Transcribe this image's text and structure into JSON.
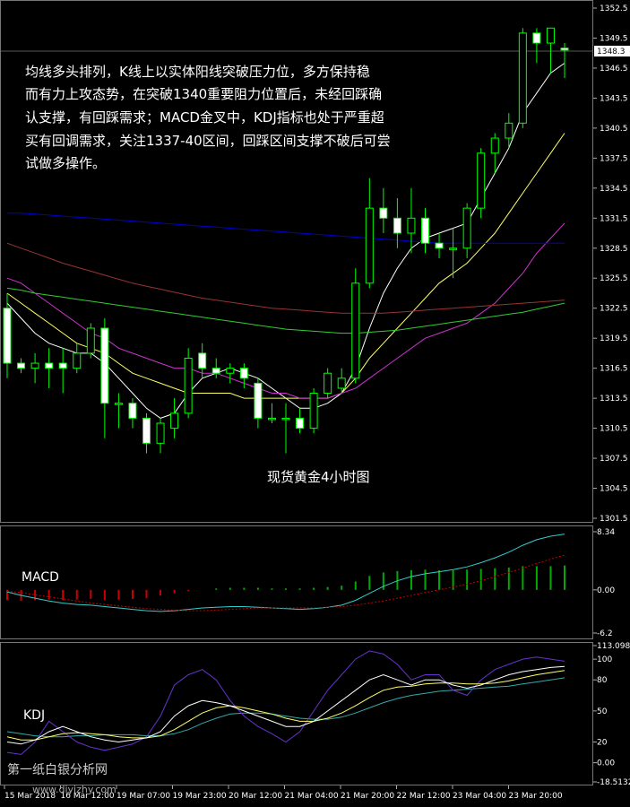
{
  "annotation": {
    "lines": [
      "均线多头排列，K线上以实体阳线突破压力位，多方保持稳",
      "而有力上攻态势，在突破1340重要阻力位置后，未经回踩确",
      "认支撑，有回踩需求；MACD金叉中，KDJ指标也处于严重超",
      "买有回调需求，关注1337-40区间，回踩区间支撑不破后可尝",
      "试做多操作。"
    ]
  },
  "watermark": {
    "text": "第一纸白银分析网",
    "url": "www.diyizhy.com"
  },
  "colors": {
    "background": "#000000",
    "grid": "#1a1a1a",
    "candle": "#00ff00",
    "candle_up_fill": "#000000",
    "candle_down_fill": "#ffffff",
    "ma_white": "#ffffff",
    "ma_yellow": "#ffff66",
    "ma_magenta": "#cc33cc",
    "ma_green": "#33cc33",
    "ma_brown": "#993333",
    "ma_blue": "#0000cc",
    "macd_line": "#33cccc",
    "macd_signal": "#cc0000",
    "macd_hist_pos": "#00aa00",
    "macd_hist_neg": "#cc0000",
    "kdj_k": "#ffffff",
    "kdj_d": "#ffff66",
    "kdj_j": "#6633cc",
    "kdj_extra": "#33aaaa"
  },
  "chart_data": [
    {
      "type": "candlestick",
      "title": "现货黄金4小时图",
      "current_price": "1348.3",
      "ylim": [
        1301.5,
        1352.5
      ],
      "y_ticks": [
        "1352.5",
        "1349.5",
        "1346.5",
        "1343.5",
        "1340.5",
        "1337.5",
        "1334.5",
        "1331.5",
        "1328.5",
        "1325.5",
        "1322.5",
        "1319.5",
        "1316.5",
        "1313.5",
        "1310.5",
        "1307.5",
        "1304.5",
        "1301.5"
      ],
      "x_ticks": [
        "15 Mar 2018",
        "16 Mar 12:00",
        "19 Mar 07:00",
        "19 Mar 23:00",
        "20 Mar 12:00",
        "21 Mar 04:00",
        "21 Mar 20:00",
        "22 Mar 12:00",
        "23 Mar 04:00",
        "23 Mar 20:00"
      ],
      "candles": [
        {
          "o": 1322.5,
          "h": 1324.0,
          "l": 1315.5,
          "c": 1317.0
        },
        {
          "o": 1317.0,
          "h": 1317.5,
          "l": 1316.0,
          "c": 1316.5
        },
        {
          "o": 1316.5,
          "h": 1318.0,
          "l": 1315.0,
          "c": 1317.0
        },
        {
          "o": 1317.0,
          "h": 1318.5,
          "l": 1314.5,
          "c": 1316.5
        },
        {
          "o": 1317.0,
          "h": 1318.5,
          "l": 1314.0,
          "c": 1316.5
        },
        {
          "o": 1316.5,
          "h": 1319.0,
          "l": 1316.0,
          "c": 1318.0
        },
        {
          "o": 1318.0,
          "h": 1321.0,
          "l": 1317.5,
          "c": 1320.5
        },
        {
          "o": 1320.5,
          "h": 1321.5,
          "l": 1309.5,
          "c": 1313.0
        },
        {
          "o": 1313.0,
          "h": 1314.0,
          "l": 1310.5,
          "c": 1313.0
        },
        {
          "o": 1313.0,
          "h": 1313.5,
          "l": 1310.5,
          "c": 1311.5
        },
        {
          "o": 1311.5,
          "h": 1312.0,
          "l": 1308.0,
          "c": 1309.0
        },
        {
          "o": 1309.0,
          "h": 1311.5,
          "l": 1308.0,
          "c": 1311.0
        },
        {
          "o": 1310.5,
          "h": 1313.5,
          "l": 1309.5,
          "c": 1312.0
        },
        {
          "o": 1312.0,
          "h": 1318.5,
          "l": 1311.5,
          "c": 1317.5
        },
        {
          "o": 1318.0,
          "h": 1319.0,
          "l": 1315.5,
          "c": 1316.5
        },
        {
          "o": 1316.5,
          "h": 1317.5,
          "l": 1315.5,
          "c": 1316.0
        },
        {
          "o": 1316.0,
          "h": 1317.0,
          "l": 1315.0,
          "c": 1316.5
        },
        {
          "o": 1316.5,
          "h": 1317.0,
          "l": 1314.5,
          "c": 1315.5
        },
        {
          "o": 1315.0,
          "h": 1315.5,
          "l": 1310.5,
          "c": 1311.5
        },
        {
          "o": 1311.5,
          "h": 1313.0,
          "l": 1311.0,
          "c": 1311.5
        },
        {
          "o": 1311.5,
          "h": 1313.0,
          "l": 1308.0,
          "c": 1311.5
        },
        {
          "o": 1311.5,
          "h": 1312.5,
          "l": 1310.0,
          "c": 1310.5
        },
        {
          "o": 1310.5,
          "h": 1314.5,
          "l": 1310.0,
          "c": 1314.0
        },
        {
          "o": 1314.0,
          "h": 1316.5,
          "l": 1313.5,
          "c": 1316.0
        },
        {
          "o": 1314.5,
          "h": 1316.5,
          "l": 1314.0,
          "c": 1315.5
        },
        {
          "o": 1315.5,
          "h": 1326.5,
          "l": 1315.0,
          "c": 1325.0
        },
        {
          "o": 1325.0,
          "h": 1335.5,
          "l": 1324.5,
          "c": 1332.5
        },
        {
          "o": 1332.5,
          "h": 1334.5,
          "l": 1330.0,
          "c": 1331.5
        },
        {
          "o": 1331.5,
          "h": 1333.5,
          "l": 1328.5,
          "c": 1330.0
        },
        {
          "o": 1330.0,
          "h": 1334.5,
          "l": 1328.0,
          "c": 1331.5
        },
        {
          "o": 1331.5,
          "h": 1332.5,
          "l": 1328.0,
          "c": 1329.0
        },
        {
          "o": 1329.0,
          "h": 1330.0,
          "l": 1327.5,
          "c": 1328.5
        },
        {
          "o": 1328.5,
          "h": 1330.5,
          "l": 1325.5,
          "c": 1328.5
        },
        {
          "o": 1328.5,
          "h": 1333.0,
          "l": 1327.5,
          "c": 1332.5
        },
        {
          "o": 1332.5,
          "h": 1338.5,
          "l": 1331.5,
          "c": 1338.0
        },
        {
          "o": 1338.0,
          "h": 1340.0,
          "l": 1336.0,
          "c": 1339.5
        },
        {
          "o": 1339.5,
          "h": 1342.0,
          "l": 1338.5,
          "c": 1341.0
        },
        {
          "o": 1341.0,
          "h": 1350.5,
          "l": 1340.5,
          "c": 1350.0
        },
        {
          "o": 1350.0,
          "h": 1350.5,
          "l": 1347.0,
          "c": 1349.0
        },
        {
          "o": 1349.0,
          "h": 1350.5,
          "l": 1346.0,
          "c": 1350.5
        },
        {
          "o": 1348.5,
          "h": 1349.0,
          "l": 1345.5,
          "c": 1348.3
        }
      ],
      "moving_averages": [
        {
          "color_key": "ma_white",
          "values": [
            1323.0,
            1321.5,
            1320.0,
            1319.0,
            1318.5,
            1318.0,
            1318.0,
            1317.0,
            1315.5,
            1314.0,
            1312.5,
            1311.5,
            1312.0,
            1314.0,
            1315.5,
            1316.0,
            1316.5,
            1316.0,
            1315.5,
            1314.5,
            1313.5,
            1312.5,
            1312.5,
            1313.0,
            1314.0,
            1316.5,
            1320.5,
            1324.0,
            1326.5,
            1328.5,
            1329.5,
            1330.0,
            1330.5,
            1331.0,
            1333.5,
            1336.0,
            1338.5,
            1342.0,
            1344.0,
            1346.0,
            1347.0
          ]
        },
        {
          "color_key": "ma_yellow",
          "values": [
            1324.0,
            1323.0,
            1322.0,
            1321.0,
            1320.0,
            1319.0,
            1318.5,
            1318.0,
            1317.0,
            1316.0,
            1315.5,
            1315.0,
            1314.5,
            1314.0,
            1314.0,
            1314.0,
            1314.0,
            1313.5,
            1313.5,
            1313.5,
            1313.5,
            1313.5,
            1313.5,
            1313.5,
            1314.0,
            1315.5,
            1317.5,
            1319.0,
            1320.5,
            1322.0,
            1323.5,
            1325.0,
            1326.0,
            1327.0,
            1328.5,
            1330.0,
            1332.0,
            1334.0,
            1336.0,
            1338.0,
            1340.0
          ]
        },
        {
          "color_key": "ma_magenta",
          "values": [
            1325.5,
            1325.0,
            1324.0,
            1323.0,
            1322.0,
            1321.0,
            1320.0,
            1319.5,
            1318.5,
            1318.0,
            1317.5,
            1317.0,
            1316.5,
            1316.5,
            1316.0,
            1316.0,
            1315.5,
            1315.0,
            1314.5,
            1314.0,
            1314.0,
            1313.5,
            1313.5,
            1313.5,
            1314.0,
            1314.5,
            1315.5,
            1316.5,
            1317.5,
            1318.5,
            1319.5,
            1320.0,
            1320.5,
            1321.0,
            1322.0,
            1323.0,
            1324.5,
            1326.0,
            1328.0,
            1329.5,
            1331.0
          ]
        },
        {
          "color_key": "ma_green",
          "values": [
            1324.5,
            1324.3,
            1324.0,
            1323.8,
            1323.6,
            1323.4,
            1323.2,
            1323.0,
            1322.8,
            1322.6,
            1322.4,
            1322.2,
            1322.0,
            1321.8,
            1321.6,
            1321.4,
            1321.2,
            1321.0,
            1320.8,
            1320.6,
            1320.4,
            1320.3,
            1320.2,
            1320.1,
            1320.0,
            1320.0,
            1320.1,
            1320.2,
            1320.3,
            1320.5,
            1320.7,
            1320.9,
            1321.1,
            1321.3,
            1321.5,
            1321.7,
            1321.9,
            1322.1,
            1322.4,
            1322.7,
            1323.0
          ]
        },
        {
          "color_key": "ma_brown",
          "values": [
            1329.0,
            1328.5,
            1328.0,
            1327.5,
            1327.0,
            1326.6,
            1326.2,
            1325.8,
            1325.4,
            1325.0,
            1324.7,
            1324.4,
            1324.1,
            1323.8,
            1323.5,
            1323.3,
            1323.1,
            1322.9,
            1322.7,
            1322.5,
            1322.4,
            1322.3,
            1322.2,
            1322.1,
            1322.0,
            1322.0,
            1322.0,
            1322.0,
            1322.1,
            1322.2,
            1322.3,
            1322.4,
            1322.5,
            1322.6,
            1322.7,
            1322.8,
            1322.9,
            1323.0,
            1323.1,
            1323.2,
            1323.3
          ]
        },
        {
          "color_key": "ma_blue",
          "values": [
            1332.0,
            1332.0,
            1331.9,
            1331.8,
            1331.7,
            1331.6,
            1331.5,
            1331.4,
            1331.3,
            1331.2,
            1331.1,
            1331.0,
            1330.9,
            1330.8,
            1330.7,
            1330.6,
            1330.5,
            1330.4,
            1330.3,
            1330.2,
            1330.1,
            1330.0,
            1329.9,
            1329.8,
            1329.7,
            1329.6,
            1329.5,
            1329.4,
            1329.3,
            1329.2,
            1329.1,
            1329.0,
            1329.0,
            1329.0,
            1329.0,
            1329.0,
            1329.0,
            1329.0,
            1329.0,
            1329.0,
            1329.0
          ]
        }
      ]
    },
    {
      "type": "macd",
      "label": "MACD",
      "ylim": [
        -6.2,
        8.34
      ],
      "y_ticks": [
        "8.34",
        "0.00",
        "-6.2"
      ],
      "histogram": [
        -1.5,
        -1.6,
        -1.5,
        -1.4,
        -1.5,
        -1.4,
        -1.3,
        -1.5,
        -1.4,
        -1.3,
        -1.2,
        -0.8,
        -0.5,
        -0.2,
        0.0,
        0.2,
        0.3,
        0.3,
        0.3,
        0.2,
        0.2,
        0.2,
        0.3,
        0.4,
        0.6,
        1.2,
        2.0,
        2.5,
        2.7,
        2.8,
        2.9,
        2.8,
        2.8,
        2.9,
        3.0,
        3.1,
        3.2,
        3.4,
        3.4,
        3.4,
        3.5
      ],
      "macd_line": [
        -0.3,
        -0.8,
        -1.2,
        -1.6,
        -1.9,
        -2.1,
        -2.2,
        -2.4,
        -2.6,
        -2.8,
        -3.0,
        -3.1,
        -3.0,
        -2.8,
        -2.6,
        -2.5,
        -2.4,
        -2.4,
        -2.5,
        -2.6,
        -2.7,
        -2.8,
        -2.7,
        -2.5,
        -2.2,
        -1.5,
        -0.5,
        0.5,
        1.3,
        1.9,
        2.3,
        2.6,
        2.9,
        3.3,
        3.9,
        4.6,
        5.4,
        6.4,
        7.2,
        7.7,
        8.0
      ],
      "signal_line": [
        -0.2,
        -0.4,
        -0.7,
        -1.0,
        -1.3,
        -1.6,
        -1.9,
        -2.1,
        -2.3,
        -2.5,
        -2.7,
        -2.8,
        -2.9,
        -3.0,
        -3.0,
        -2.9,
        -2.8,
        -2.7,
        -2.6,
        -2.6,
        -2.6,
        -2.6,
        -2.6,
        -2.5,
        -2.4,
        -2.2,
        -1.9,
        -1.6,
        -1.2,
        -0.8,
        -0.4,
        0.0,
        0.4,
        0.8,
        1.3,
        1.9,
        2.5,
        3.1,
        3.8,
        4.4,
        5.0
      ]
    },
    {
      "type": "kdj",
      "label": "KDJ",
      "ylim": [
        -18.5132,
        113.0982
      ],
      "y_ticks": [
        "113.0982",
        "100",
        "80",
        "50",
        "20",
        "0.00",
        "-18.5132"
      ],
      "k": [
        20,
        18,
        22,
        30,
        35,
        30,
        25,
        22,
        20,
        22,
        24,
        30,
        45,
        55,
        60,
        58,
        55,
        50,
        45,
        40,
        35,
        35,
        40,
        50,
        60,
        70,
        80,
        85,
        80,
        75,
        80,
        80,
        75,
        72,
        75,
        80,
        85,
        88,
        90,
        92,
        93
      ],
      "d": [
        25,
        22,
        22,
        25,
        28,
        29,
        28,
        27,
        25,
        24,
        24,
        26,
        32,
        40,
        48,
        53,
        55,
        53,
        50,
        47,
        43,
        40,
        40,
        43,
        48,
        55,
        63,
        70,
        73,
        74,
        76,
        77,
        77,
        76,
        76,
        77,
        79,
        82,
        85,
        87,
        89
      ],
      "j": [
        10,
        8,
        20,
        40,
        30,
        20,
        15,
        12,
        15,
        18,
        25,
        45,
        75,
        85,
        90,
        80,
        60,
        45,
        35,
        28,
        20,
        30,
        50,
        70,
        85,
        100,
        108,
        105,
        95,
        80,
        85,
        85,
        70,
        65,
        80,
        90,
        95,
        100,
        102,
        100,
        98
      ],
      "extra": [
        30,
        28,
        26,
        25,
        25,
        26,
        26,
        27,
        27,
        27,
        26,
        26,
        28,
        32,
        38,
        43,
        47,
        48,
        48,
        47,
        45,
        43,
        42,
        42,
        44,
        48,
        53,
        58,
        62,
        65,
        67,
        69,
        70,
        71,
        72,
        73,
        74,
        76,
        78,
        80,
        82
      ]
    }
  ]
}
